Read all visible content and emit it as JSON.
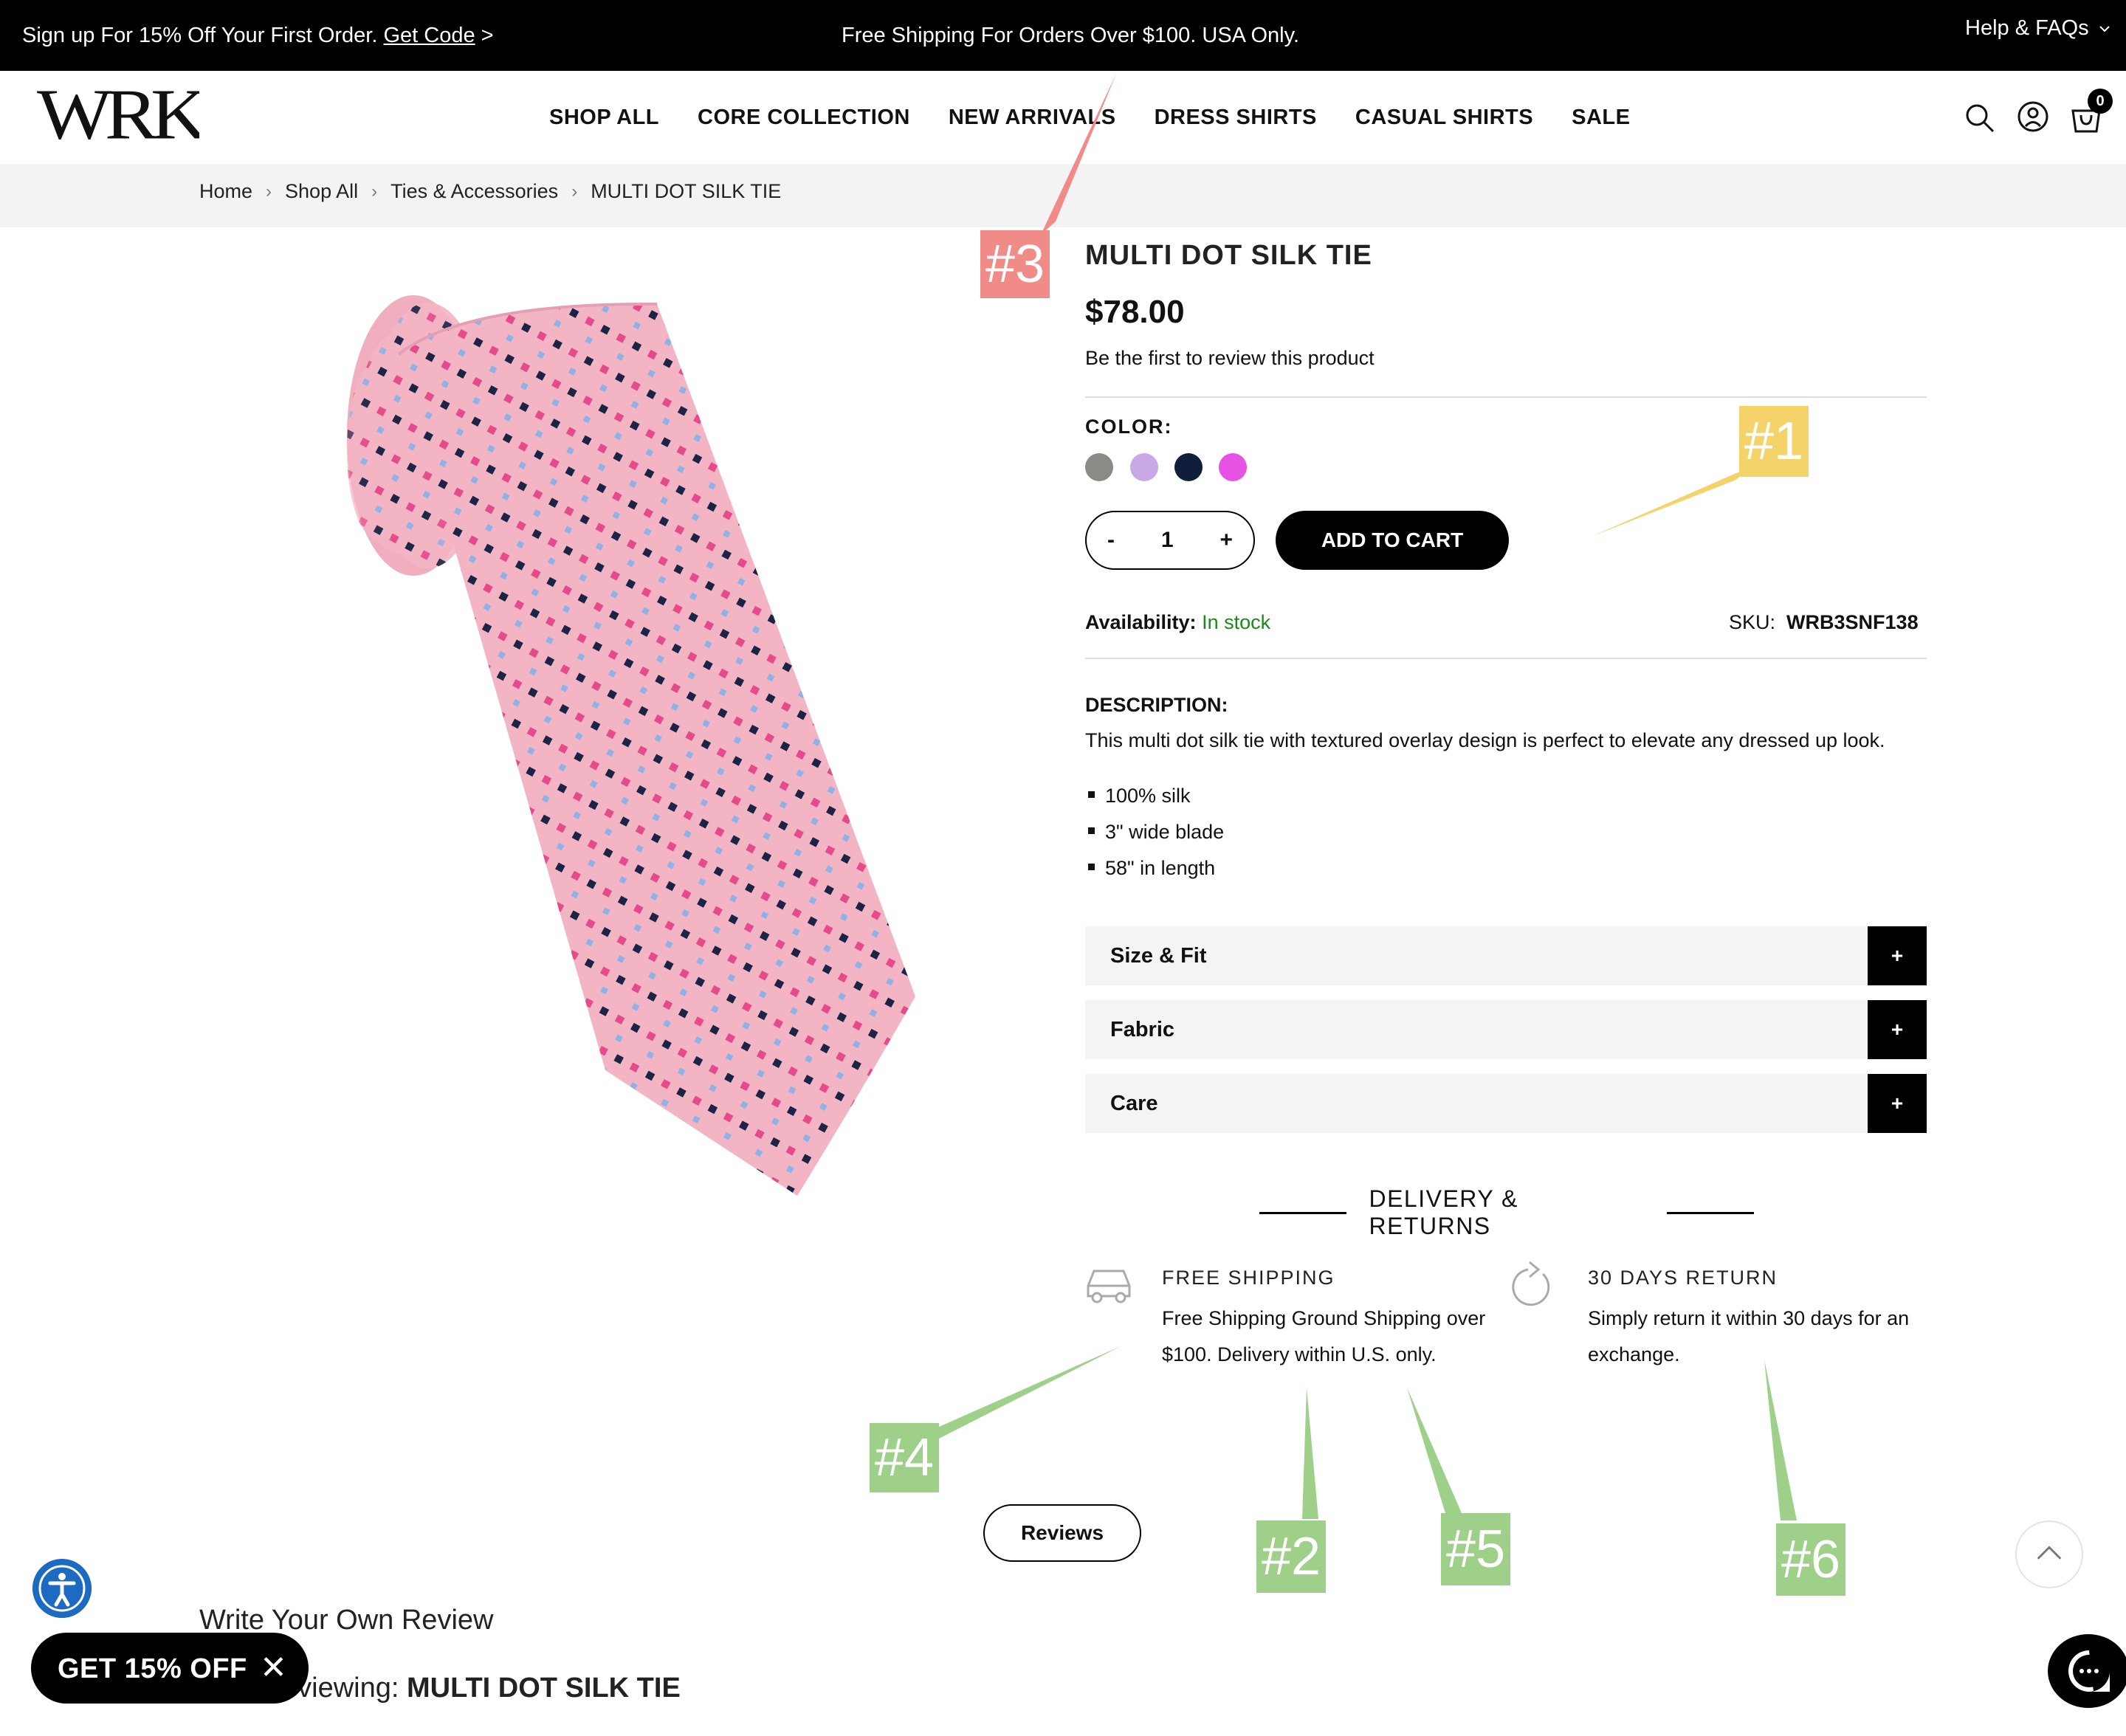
{
  "topbar": {
    "signup_text": "Sign up For 15% Off Your First Order. ",
    "get_code": "Get Code",
    "signup_arrow": " >",
    "shipping": "Free Shipping For Orders Over $100. USA Only.",
    "help": "Help & FAQs"
  },
  "brand": "WRK",
  "nav": [
    "SHOP ALL",
    "CORE COLLECTION",
    "NEW ARRIVALS",
    "DRESS SHIRTS",
    "CASUAL SHIRTS",
    "SALE"
  ],
  "cart_count": "0",
  "breadcrumb": [
    "Home",
    "Shop All",
    "Ties & Accessories",
    "MULTI DOT SILK TIE"
  ],
  "product": {
    "title": "MULTI DOT SILK TIE",
    "price": "$78.00",
    "review_prompt": "Be the first to review this product",
    "color_label": "COLOR:",
    "swatches": [
      "#8a8a86",
      "#c9a8e6",
      "#0f1e3a",
      "#e552e4"
    ],
    "quantity": "1",
    "qty_minus": "-",
    "qty_plus": "+",
    "add_to_cart": "ADD TO CART",
    "availability_label": "Availability:",
    "availability_value": "In stock",
    "sku_label": "SKU:",
    "sku_value": "WRB3SNF138",
    "description_label": "DESCRIPTION:",
    "description": "This multi dot silk tie with textured overlay design is perfect to elevate any dressed up look.",
    "bullets": [
      "100% silk",
      "3\" wide blade",
      "58\" in length"
    ],
    "accordions": [
      "Size & Fit",
      "Fabric",
      "Care"
    ],
    "accordion_toggle": "+"
  },
  "delivery": {
    "heading": "DELIVERY & RETURNS",
    "shipping_title": "FREE SHIPPING",
    "shipping_line1": "Free Shipping Ground Shipping over",
    "shipping_line2": "$100. Delivery within U.S. only.",
    "return_title": "30 DAYS RETURN",
    "return_line1": "Simply return it within 30 days for an",
    "return_line2": "exchange."
  },
  "reviews_button": "Reviews",
  "write_review": "Write Your Own Review",
  "reviewing_prefix": "eviewing: ",
  "reviewing_product": "MULTI DOT SILK TIE",
  "promo": {
    "label": "GET 15% OFF",
    "close": "✕"
  },
  "markers": [
    {
      "label": "#1",
      "color": "#f5d36b"
    },
    {
      "label": "#2",
      "color": "#9fd08a"
    },
    {
      "label": "#3",
      "color": "#f08b87"
    },
    {
      "label": "#4",
      "color": "#9fd08a"
    },
    {
      "label": "#5",
      "color": "#9fd08a"
    },
    {
      "label": "#6",
      "color": "#9fd08a"
    }
  ],
  "colors": {
    "in_stock": "#1a8a1a",
    "tie_pink": "#f3b5c4",
    "accessibility_blue": "#1d6ac2"
  }
}
